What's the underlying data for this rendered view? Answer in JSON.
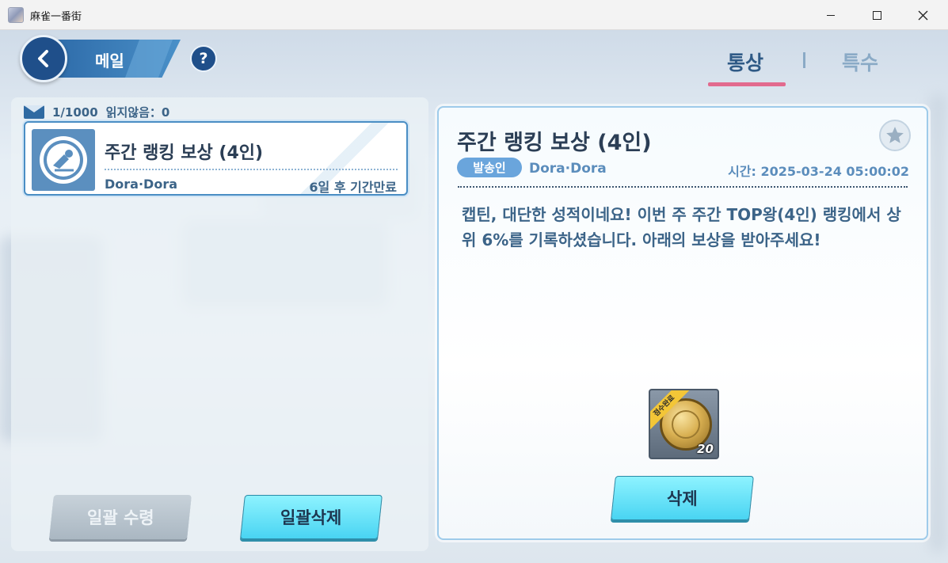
{
  "window": {
    "title": "麻雀一番街"
  },
  "header": {
    "title": "메일",
    "help_label": "?",
    "tabs": [
      {
        "label": "통상",
        "active": true
      },
      {
        "label": "특수",
        "active": false
      }
    ]
  },
  "mail_list": {
    "count_text": "1/1000",
    "unread_text": "읽지않음：0",
    "items": [
      {
        "icon": "reward-medal-icon",
        "title": "주간 랭킹 보상 (4인)",
        "sender": "Dora·Dora",
        "expire": "6일 후 기간만료"
      }
    ],
    "receive_all_label": "일괄 수령",
    "delete_all_label": "일괄삭제"
  },
  "detail": {
    "title": "주간 랭킹 보상 (4인)",
    "sender_badge": "발송인",
    "sender_name": "Dora·Dora",
    "time": "시간: 2025-03-24  05:00:02",
    "body": "캡틴, 대단한 성적이네요! 이번 주 주간 TOP왕(4인) 랭킹에서 상위 6%를 기록하셨습니다. 아래의 보상을 받아주세요!",
    "reward": {
      "icon": "gold-coin-icon",
      "ribbon": "점수완료",
      "quantity": "20"
    },
    "delete_label": "삭제"
  },
  "colors": {
    "accent_dark": "#1f4f8a",
    "tab_underline": "#e26a8e",
    "button_cyan": "#49d4f2",
    "text_blue": "#3c6488"
  }
}
